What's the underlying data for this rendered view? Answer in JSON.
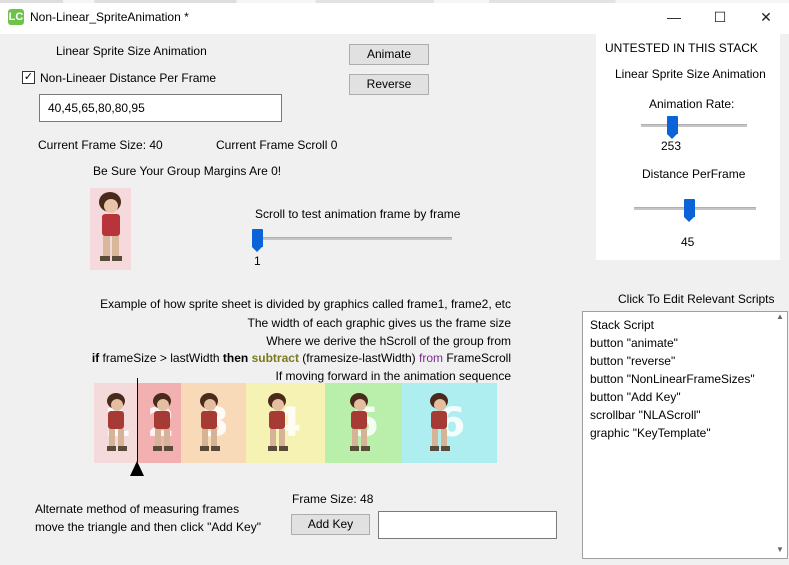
{
  "window": {
    "title": "Non-Linear_SpriteAnimation *",
    "logo": "LC",
    "minimize_glyph": "—",
    "maximize_glyph": "☐",
    "close_glyph": "✕"
  },
  "controls": {
    "heading": "Linear Sprite Size Animation",
    "checkbox_label": "Non-Lineaer Distance Per Frame",
    "checkbox_checked": true,
    "checkbox_glyph": "✓",
    "distance_field_value": "40,45,65,80,80,95",
    "animate_button": "Animate",
    "reverse_button": "Reverse",
    "current_frame_size": "Current Frame Size: 40",
    "current_frame_scroll": "Current Frame Scroll 0",
    "margins_note": "Be Sure Your Group Margins Are 0!",
    "scroll_label": "Scroll to test animation frame by frame",
    "scroll_value": "1",
    "scroll_fraction": 0.0
  },
  "right_panel": {
    "untested_label": "UNTESTED IN THIS STACK",
    "heading": "Linear Sprite Size Animation",
    "rate_label": "Animation Rate:",
    "rate_value": "253",
    "rate_fraction": 0.27,
    "distance_label": "Distance PerFrame",
    "distance_value": "45",
    "distance_fraction": 0.45
  },
  "explanation": {
    "line1": "Example of how sprite sheet is divided by graphics called frame1, frame2, etc",
    "line2": "The width of each graphic gives us the frame size",
    "line3": "Where we derive the hScroll of the group  from",
    "line4_if": "if",
    "line4_a": " frameSize > lastWidth ",
    "line4_then": "then",
    "line4_subtract": " subtract",
    "line4_b": " (framesize-lastWidth) ",
    "line4_from": "from",
    "line4_c": " FrameScroll",
    "line5": "If moving forward in the animation sequence"
  },
  "sprite_strip": {
    "frames": [
      "1",
      "2",
      "3",
      "4",
      "5",
      "6"
    ],
    "colors": [
      "#f4dada",
      "#f3b0b0",
      "#f8d9b8",
      "#f6f2b4",
      "#b9efaa",
      "#aeeef0"
    ]
  },
  "bottom": {
    "alt_line1": "Alternate method of measuring frames",
    "alt_line2": "move the triangle and then  click \"Add Key\"",
    "frame_size_label": "Frame Size: 48",
    "add_key_button": "Add Key",
    "key_field_value": ""
  },
  "scripts": {
    "title": "Click To Edit Relevant Scripts",
    "items": [
      "Stack Script",
      "button \"animate\"",
      "button \"reverse\"",
      "button \"NonLinearFrameSizes\"",
      "button \"Add Key\"",
      "scrollbar \"NLAScroll\"",
      "graphic \"KeyTemplate\""
    ]
  }
}
